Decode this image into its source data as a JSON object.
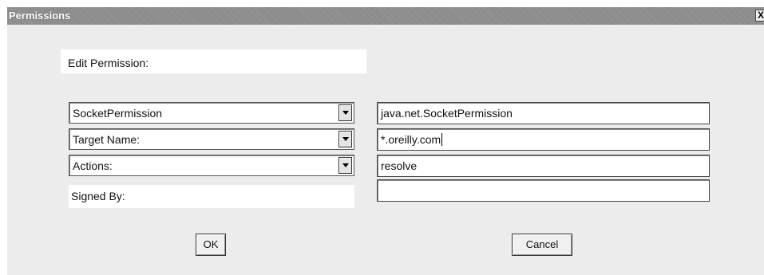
{
  "window": {
    "title": "Permissions",
    "close_glyph": "X"
  },
  "form": {
    "heading": "Edit Permission:",
    "permission_type": {
      "selected": "SocketPermission",
      "value": "java.net.SocketPermission"
    },
    "target_name": {
      "selected": "Target Name:",
      "value": "*.oreilly.com"
    },
    "actions": {
      "selected": "Actions:",
      "value": "resolve"
    },
    "signed_by": {
      "label": "Signed By:",
      "value": ""
    }
  },
  "buttons": {
    "ok": "OK",
    "cancel": "Cancel"
  },
  "icons": {
    "close": "close-icon",
    "dropdown": "chevron-down-icon"
  }
}
